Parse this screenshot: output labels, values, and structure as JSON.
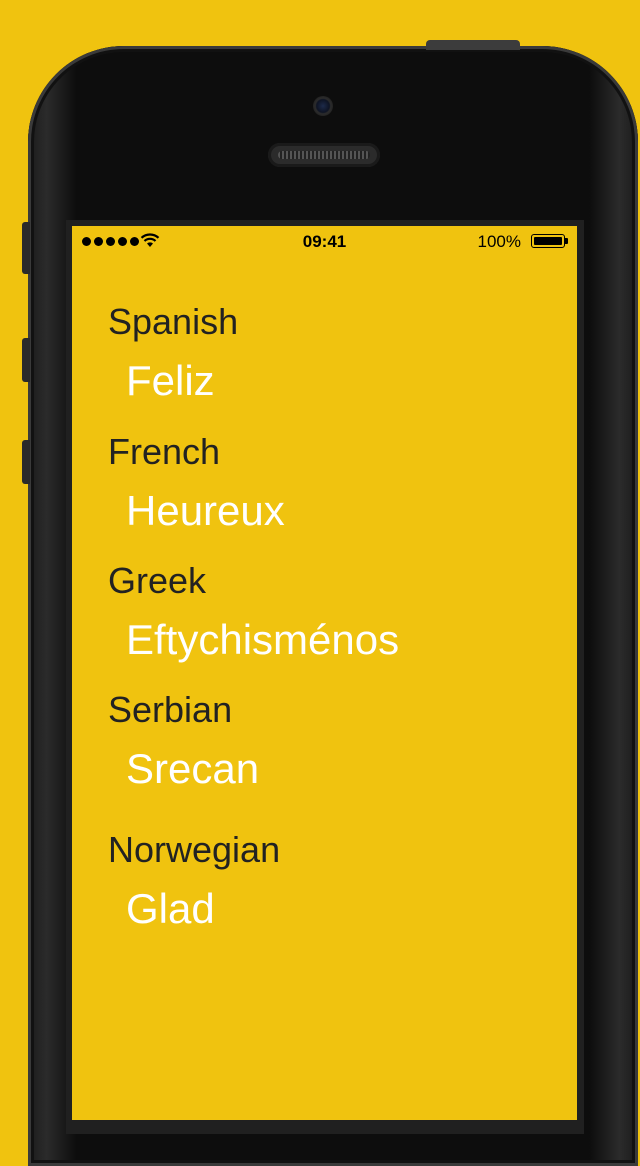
{
  "status_bar": {
    "signal_icon": "signal-dots-icon",
    "wifi_icon": "wifi-icon",
    "time": "09:41",
    "battery_percent": "100%",
    "battery_icon": "battery-icon",
    "battery_level": 1.0
  },
  "colors": {
    "background": "#f0c30f",
    "language_text": "#222222",
    "translation_text": "#ffffff"
  },
  "translations": [
    {
      "language": "Spanish",
      "word": "Feliz"
    },
    {
      "language": "French",
      "word": "Heureux"
    },
    {
      "language": "Greek",
      "word": "Eftychisménos"
    },
    {
      "language": "Serbian",
      "word": "Srecan"
    },
    {
      "language": "Norwegian",
      "word": "Glad"
    }
  ]
}
